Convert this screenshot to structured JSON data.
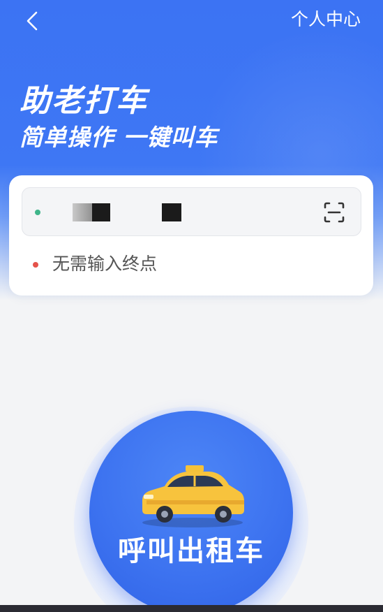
{
  "header": {
    "back_icon": "chevron-left-icon",
    "profile_link": "个人中心"
  },
  "hero": {
    "title": "助老打车",
    "subtitle": "简单操作 一键叫车"
  },
  "route_card": {
    "origin": {
      "value": "",
      "status_color": "#3fb58a",
      "scan_icon": "scan-icon"
    },
    "destination": {
      "text": "无需输入终点",
      "status_color": "#e5534b"
    }
  },
  "call_button": {
    "label": "呼叫出租车",
    "icon": "taxi-icon"
  },
  "colors": {
    "primary": "#3d73f0",
    "background": "#f3f4f6"
  }
}
